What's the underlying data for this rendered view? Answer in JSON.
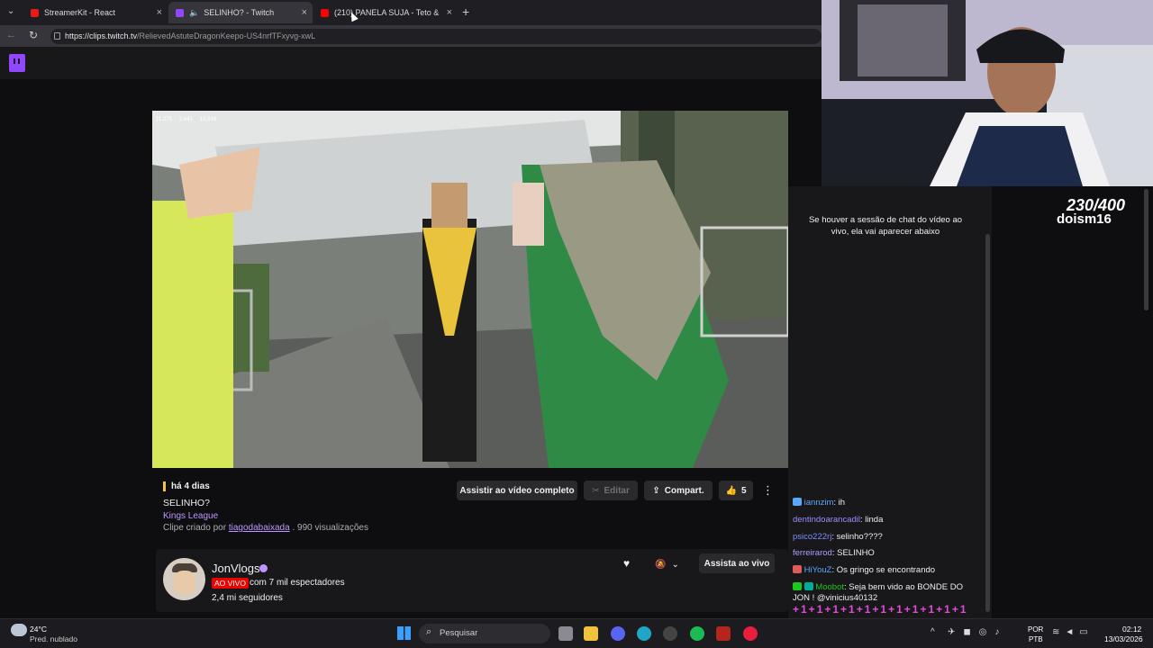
{
  "browser": {
    "tabs": [
      {
        "title": "StreamerKit - React",
        "color": "#e91916"
      },
      {
        "title": "SELINHO? - Twitch",
        "color": "#9147ff"
      },
      {
        "title": "(210) PANELA SUJA - Teto & WIU",
        "color": "#ff0000"
      }
    ],
    "url_host": "https://clips.twitch.tv",
    "url_path": "/RelievedAstuteDragonKeepo-US4nrfTFxyvg-xwL"
  },
  "video_overlay": {
    "stat1": "11.275",
    "stat2": "2.641",
    "stat3": "13.916"
  },
  "clip": {
    "age": "há 4 dias",
    "title": "SELINHO?",
    "category": "Kings League",
    "created_by_label": "Clipe criado por",
    "creator": "tiagodabaixada",
    "views": ". 990 visualizações",
    "buttons": {
      "full_video": "Assistir ao vídeo completo",
      "edit": "Editar",
      "share": "Compart.",
      "likes": "5"
    }
  },
  "channel": {
    "name": "JonVlogs",
    "live_badge": "AO VIVO",
    "viewers": "com 7 mil espectadores",
    "followers": "2,4 mi seguidores",
    "watch_live": "Assista ao vivo"
  },
  "chat": {
    "notice": "Se houver a sessão de chat do vídeo ao vivo, ela vai aparecer abaixo",
    "messages": [
      {
        "user": "iannzim",
        "text": ": ih",
        "color": "#5aa7ff"
      },
      {
        "user": "dentindoarancadil",
        "text": ": linda",
        "color": "#9b8cff"
      },
      {
        "user": "psico222rj",
        "text": ": selinho????",
        "color": "#7d8dff"
      },
      {
        "user": "ferreirarod",
        "text": ": SELINHO",
        "color": "#b49cff"
      },
      {
        "user": "HiYouZ",
        "text": ": Os gringo se encontrando",
        "color": "#5aa7ff"
      },
      {
        "user": "Moobot",
        "text": ": Seja bem vido ao BONDE DO JON ! @vinicius40132",
        "color": "#1ec71e"
      }
    ]
  },
  "stream_overlay": {
    "counter": "230/400",
    "name": "doism16"
  },
  "taskbar": {
    "weather_temp": "24°C",
    "weather_desc": "Pred. nublado",
    "search": "Pesquisar",
    "lang1": "POR",
    "lang2": "PTB",
    "time": "02:12",
    "date": "13/03/2026"
  }
}
